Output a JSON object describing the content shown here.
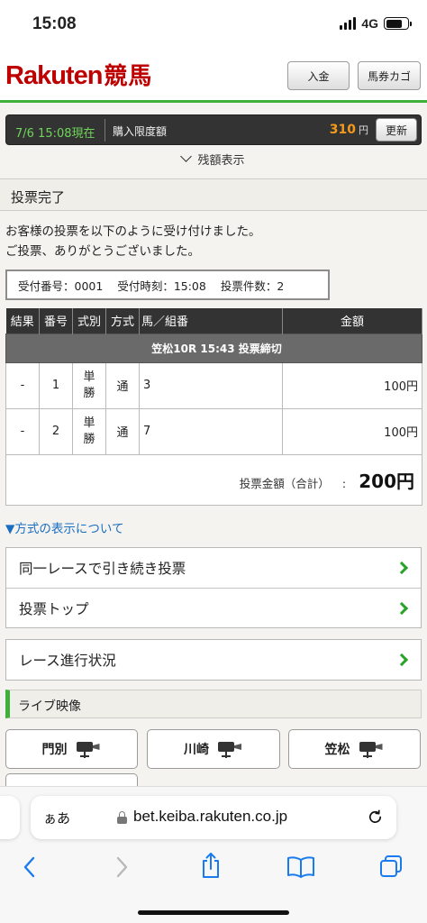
{
  "status_bar": {
    "time": "15:08",
    "network": "4G"
  },
  "header": {
    "logo_text": "Rakuten",
    "logo_kanji": "競馬",
    "deposit_button": "入金",
    "cart_button": "馬券カゴ"
  },
  "info_bar": {
    "timestamp": "7/6 15:08現在",
    "limit_label": "購入限度額",
    "limit_amount": "310",
    "currency": "円",
    "refresh_button": "更新"
  },
  "balance_toggle": "残額表示",
  "section_title": "投票完了",
  "message": {
    "line1": "お客様の投票を以下のように受け付けました。",
    "line2": "ご投票、ありがとうございました。"
  },
  "receipt": {
    "number": "受付番号：0001",
    "time": "受付時刻：15:08",
    "count": "投票件数：2"
  },
  "table": {
    "headers": [
      "結果",
      "番号",
      "式別",
      "方式",
      "馬／組番",
      "金額"
    ],
    "race_info": "笠松10R 15:43 投票締切",
    "rows": [
      {
        "result": "-",
        "number": "1",
        "type_top": "単",
        "type_bottom": "勝",
        "method": "通",
        "combo": "3",
        "amount": "100円"
      },
      {
        "result": "-",
        "number": "2",
        "type_top": "単",
        "type_bottom": "勝",
        "method": "通",
        "combo": "7",
        "amount": "100円"
      }
    ],
    "total_label": "投票金額（合計）",
    "total_sep": ":",
    "total_value": "200円"
  },
  "method_link": "▼方式の表示について",
  "nav": {
    "continue_vote": "同一レースで引き続き投票",
    "vote_top": "投票トップ",
    "race_progress": "レース進行状況"
  },
  "live": {
    "title": "ライブ映像",
    "tracks": [
      "門別",
      "川崎",
      "笠松"
    ]
  },
  "browser": {
    "aa_label": "ぁあ",
    "url": "bet.keiba.rakuten.co.jp"
  }
}
